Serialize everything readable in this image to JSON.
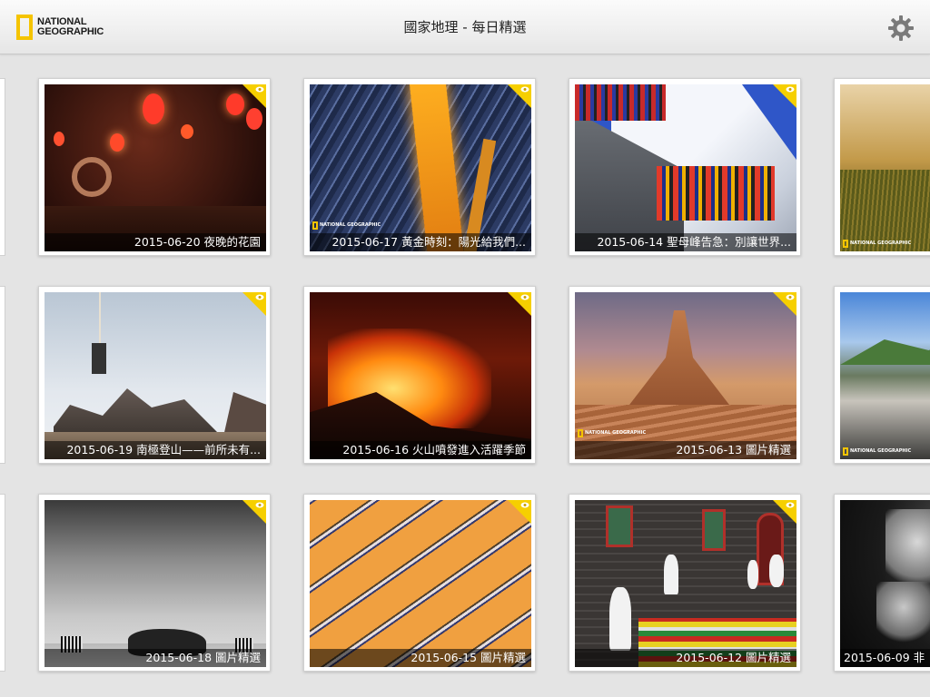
{
  "app": {
    "logo_line1": "NATIONAL",
    "logo_line2": "GEOGRAPHIC",
    "title": "國家地理 - 每日精選",
    "brand_color": "#f5c400"
  },
  "icons": {
    "settings": "gear-icon",
    "viewed": "eye-icon"
  },
  "tiles": [
    {
      "caption": "2015-06-20 夜晚的花園",
      "theme": "night-garden"
    },
    {
      "caption": "2015-06-17 黃金時刻：陽光給我們...",
      "theme": "paris-city"
    },
    {
      "caption": "2015-06-14 聖母峰告急：別讓世界...",
      "theme": "everest"
    },
    {
      "caption": "",
      "theme": "golden-forest"
    },
    {
      "caption": "2015-06-19 南極登山——前所未有...",
      "theme": "antarctica"
    },
    {
      "caption": "2015-06-16 火山噴發進入活躍季節",
      "theme": "volcano"
    },
    {
      "caption": "2015-06-13 圖片精選",
      "theme": "desert-butte"
    },
    {
      "caption": "",
      "theme": "coast"
    },
    {
      "caption": "2015-06-18 圖片精選",
      "theme": "rhino"
    },
    {
      "caption": "2015-06-15 圖片精選",
      "theme": "parking-lot"
    },
    {
      "caption": "2015-06-12 圖片精選",
      "theme": "church"
    },
    {
      "caption": "2015-06-09 非",
      "theme": "lions"
    }
  ],
  "mini_logo": "NATIONAL GEOGRAPHIC"
}
